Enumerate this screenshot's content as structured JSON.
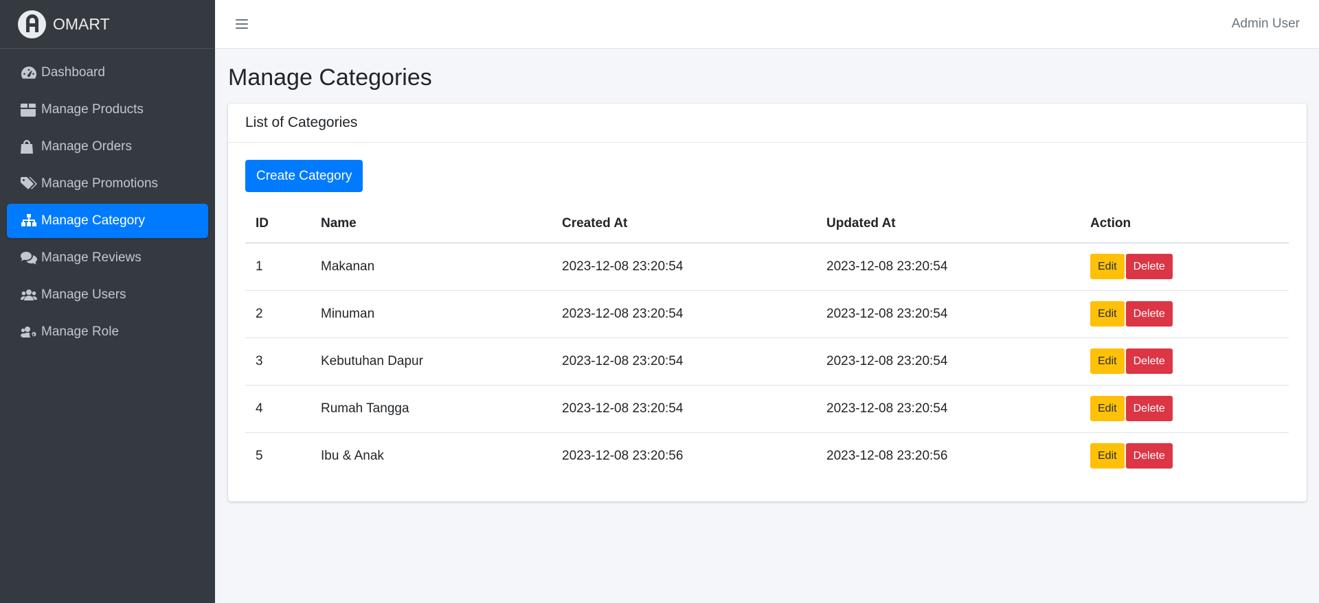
{
  "brand": {
    "name": "OMART",
    "logo_letter": "A"
  },
  "sidebar": {
    "items": [
      {
        "label": "Dashboard",
        "icon": "tachometer-icon",
        "active": false
      },
      {
        "label": "Manage Products",
        "icon": "box-icon",
        "active": false
      },
      {
        "label": "Manage Orders",
        "icon": "shopping-bag-icon",
        "active": false
      },
      {
        "label": "Manage Promotions",
        "icon": "tags-icon",
        "active": false
      },
      {
        "label": "Manage Category",
        "icon": "sitemap-icon",
        "active": true
      },
      {
        "label": "Manage Reviews",
        "icon": "comments-icon",
        "active": false
      },
      {
        "label": "Manage Users",
        "icon": "users-icon",
        "active": false
      },
      {
        "label": "Manage Role",
        "icon": "users-cog-icon",
        "active": false
      }
    ]
  },
  "header": {
    "user": "Admin User"
  },
  "page": {
    "title": "Manage Categories"
  },
  "card": {
    "title": "List of Categories",
    "create_label": "Create Category",
    "columns": [
      "ID",
      "Name",
      "Created At",
      "Updated At",
      "Action"
    ],
    "rows": [
      {
        "id": "1",
        "name": "Makanan",
        "created_at": "2023-12-08 23:20:54",
        "updated_at": "2023-12-08 23:20:54"
      },
      {
        "id": "2",
        "name": "Minuman",
        "created_at": "2023-12-08 23:20:54",
        "updated_at": "2023-12-08 23:20:54"
      },
      {
        "id": "3",
        "name": "Kebutuhan Dapur",
        "created_at": "2023-12-08 23:20:54",
        "updated_at": "2023-12-08 23:20:54"
      },
      {
        "id": "4",
        "name": "Rumah Tangga",
        "created_at": "2023-12-08 23:20:54",
        "updated_at": "2023-12-08 23:20:54"
      },
      {
        "id": "5",
        "name": "Ibu & Anak",
        "created_at": "2023-12-08 23:20:56",
        "updated_at": "2023-12-08 23:20:56"
      }
    ],
    "edit_label": "Edit",
    "delete_label": "Delete"
  },
  "colors": {
    "sidebar_bg": "#343a40",
    "primary": "#007bff",
    "warning": "#ffc107",
    "danger": "#dc3545"
  }
}
